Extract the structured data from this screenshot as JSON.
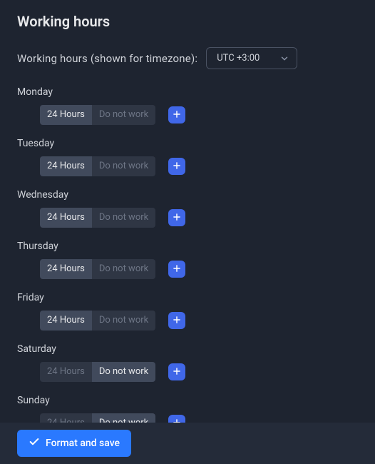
{
  "title": "Working hours",
  "timezone": {
    "label": "Working hours (shown for timezone):",
    "value": "UTC +3:00"
  },
  "segments": {
    "hours24": "24 Hours",
    "doNotWork": "Do not work"
  },
  "days": [
    {
      "name": "Monday",
      "selected": "hours24"
    },
    {
      "name": "Tuesday",
      "selected": "hours24"
    },
    {
      "name": "Wednesday",
      "selected": "hours24"
    },
    {
      "name": "Thursday",
      "selected": "hours24"
    },
    {
      "name": "Friday",
      "selected": "hours24"
    },
    {
      "name": "Saturday",
      "selected": "doNotWork"
    },
    {
      "name": "Sunday",
      "selected": "doNotWork"
    }
  ],
  "footer": {
    "saveLabel": "Format and save"
  }
}
